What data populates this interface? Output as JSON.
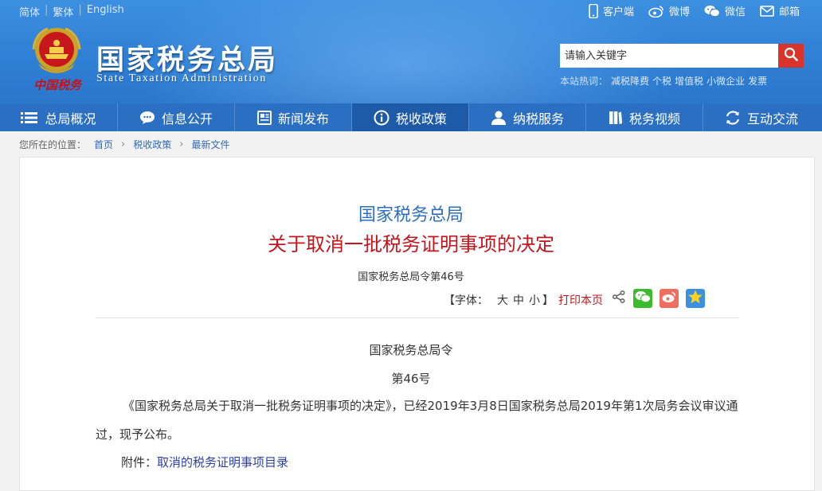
{
  "header": {
    "lang_links": [
      "简体",
      "繁体",
      "English"
    ],
    "top_links": [
      {
        "icon": "mobile-icon",
        "label": "客户端"
      },
      {
        "icon": "weibo-icon",
        "label": "微博"
      },
      {
        "icon": "wechat-icon",
        "label": "微信"
      },
      {
        "icon": "mail-icon",
        "label": "邮箱"
      }
    ],
    "emblem_caption": "中国税务",
    "brand_cn": "国家税务总局",
    "brand_en": "State Taxation Administration",
    "search": {
      "placeholder": "请输入关键字"
    },
    "hotwords_label": "本站热词：",
    "hotwords": [
      "减税降费",
      "个税",
      "增值税",
      "小微企业",
      "发票"
    ]
  },
  "nav": [
    {
      "label": "总局概况",
      "icon": "menu-icon"
    },
    {
      "label": "信息公开",
      "icon": "chat-bubble-icon"
    },
    {
      "label": "新闻发布",
      "icon": "newspaper-icon"
    },
    {
      "label": "税收政策",
      "icon": "info-icon",
      "active": true
    },
    {
      "label": "纳税服务",
      "icon": "person-icon"
    },
    {
      "label": "税务视频",
      "icon": "video-book-icon"
    },
    {
      "label": "互动交流",
      "icon": "sync-icon"
    }
  ],
  "breadcrumb": {
    "label": "您所在的位置：",
    "items": [
      "首页",
      "税收政策",
      "最新文件"
    ]
  },
  "article": {
    "title_line1": "国家税务总局",
    "title_line2": "关于取消一批税务证明事项的决定",
    "doc_number": "国家税务总局令第46号",
    "font_label": "【字体：",
    "font_sizes": [
      "大",
      "中",
      "小"
    ],
    "font_close": "】",
    "print_label": "打印本页",
    "issuer": "国家税务总局令",
    "order_no": "第46号",
    "paragraph": "《国家税务总局关于取消一批税务证明事项的决定》，已经2019年3月8日国家税务总局2019年第1次局务会议审议通过，现予公布。",
    "attachment_label": "附件：",
    "attachment_link": "取消的税务证明事项目录"
  },
  "colors": {
    "header_blue": "#2f80d6",
    "nav_blue": "#2a6fc2",
    "nav_active": "#1d5aa8",
    "title_blue": "#2e6fbd",
    "title_red": "#c4141c",
    "search_button": "#d9342b"
  }
}
